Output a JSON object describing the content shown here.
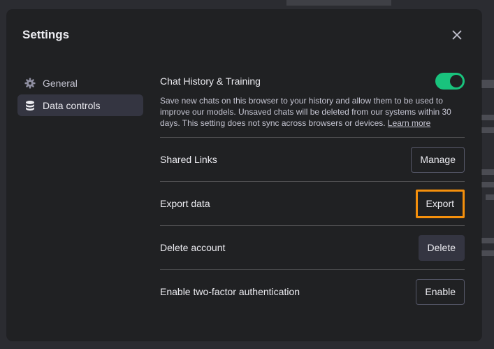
{
  "settings": {
    "title": "Settings",
    "close_icon": "close-icon",
    "nav": {
      "items": [
        {
          "label": "General",
          "icon": "gear-icon",
          "active": false
        },
        {
          "label": "Data controls",
          "icon": "database-icon",
          "active": true
        }
      ]
    },
    "chat_history": {
      "title": "Chat History & Training",
      "description": "Save new chats on this browser to your history and allow them to be used to improve our models. Unsaved chats will be deleted from our systems within 30 days. This setting does not sync across browsers or devices.",
      "learn_more": "Learn more",
      "enabled": true
    },
    "rows": {
      "shared_links": {
        "label": "Shared Links",
        "button": "Manage"
      },
      "export_data": {
        "label": "Export data",
        "button": "Export"
      },
      "delete_account": {
        "label": "Delete account",
        "button": "Delete"
      },
      "two_factor": {
        "label": "Enable two-factor authentication",
        "button": "Enable"
      }
    },
    "colors": {
      "toggle_on": "#19c37d",
      "highlight": "#f5900c",
      "modal_bg": "#202123"
    }
  }
}
